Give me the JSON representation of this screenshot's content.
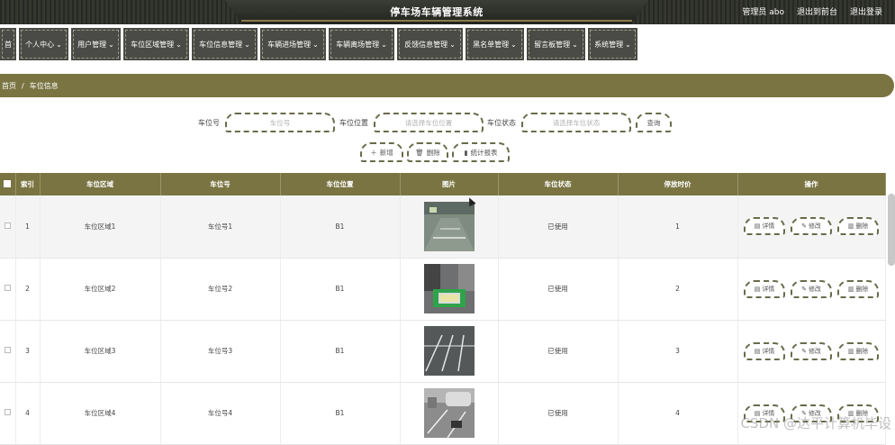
{
  "header": {
    "title": "停车场车辆管理系统",
    "user": "管理员 abo",
    "to_front": "退出到前台",
    "logout": "退出登录"
  },
  "nav": [
    {
      "label": "首",
      "width": 18
    },
    {
      "label": "个人中心",
      "width": 55
    },
    {
      "label": "用户管理",
      "width": 55
    },
    {
      "label": "车位区域管理",
      "width": 73
    },
    {
      "label": "车位信息管理",
      "width": 73
    },
    {
      "label": "车辆进场管理",
      "width": 73
    },
    {
      "label": "车辆离场管理",
      "width": 73
    },
    {
      "label": "反馈信息管理",
      "width": 73
    },
    {
      "label": "黑名单管理",
      "width": 65
    },
    {
      "label": "留言板管理",
      "width": 65
    },
    {
      "label": "系统管理",
      "width": 55
    }
  ],
  "breadcrumb": {
    "home": "首页",
    "sep": "/",
    "current": "车位信息"
  },
  "search": {
    "spot_no_label": "车位号",
    "spot_no_placeholder": "车位号",
    "location_label": "车位位置",
    "location_placeholder": "请选择车位位置",
    "status_label": "车位状态",
    "status_placeholder": "请选择车位状态",
    "query_button": "查询",
    "add_button": "新增",
    "delete_button": "删除",
    "report_button": "统计报表"
  },
  "table": {
    "headers": [
      "",
      "索引",
      "车位区域",
      "车位号",
      "车位位置",
      "图片",
      "车位状态",
      "停放时价",
      "操作"
    ],
    "rows": [
      {
        "index": "1",
        "area": "车位区域1",
        "spot": "车位号1",
        "location": "B1",
        "status": "已使用",
        "price": "1"
      },
      {
        "index": "2",
        "area": "车位区域2",
        "spot": "车位号2",
        "location": "B1",
        "status": "已使用",
        "price": "2"
      },
      {
        "index": "3",
        "area": "车位区域3",
        "spot": "车位号3",
        "location": "B1",
        "status": "已使用",
        "price": "3"
      },
      {
        "index": "4",
        "area": "车位区域4",
        "spot": "车位号4",
        "location": "B1",
        "status": "已使用",
        "price": "4"
      }
    ],
    "actions": {
      "detail": "详情",
      "edit": "修改",
      "delete": "删除"
    }
  },
  "watermark": "CSDN @达平计算机毕设",
  "colors": {
    "accent": "#7a7442",
    "nav_bg": "#4a4b46",
    "dash": "#6a6b4a"
  }
}
